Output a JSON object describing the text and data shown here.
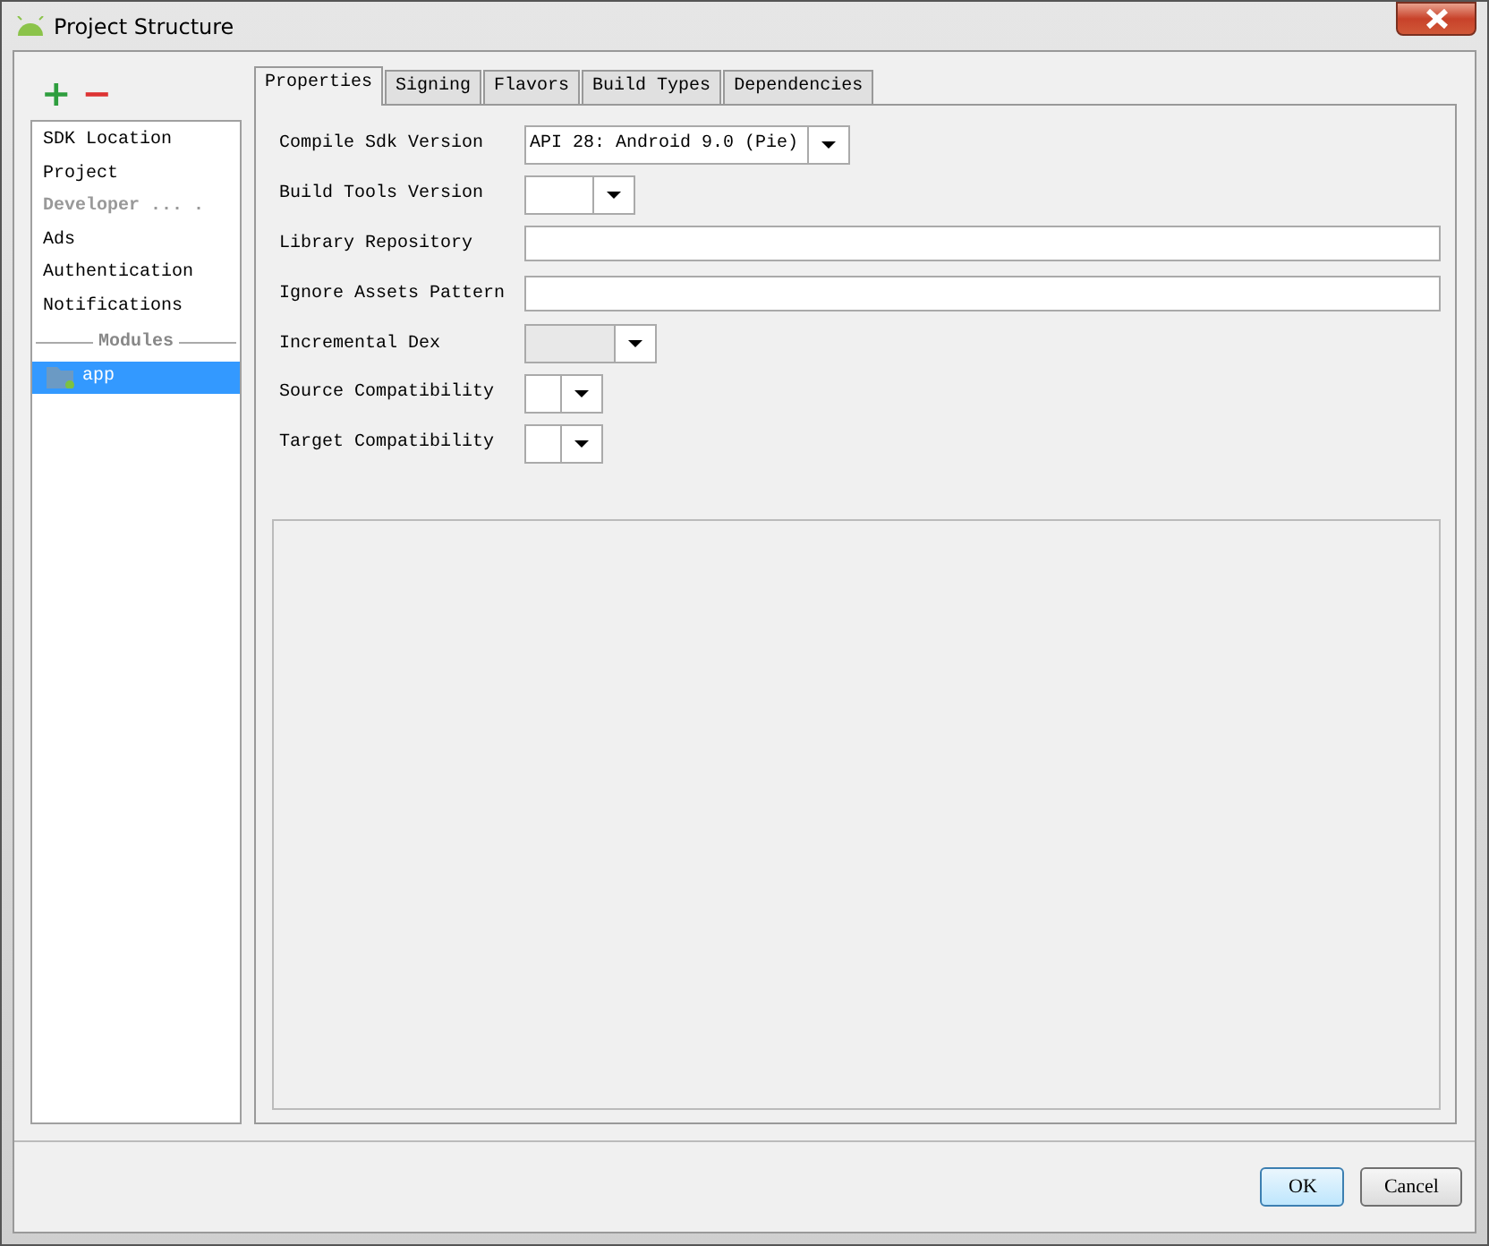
{
  "window": {
    "title": "Project Structure"
  },
  "toolbar": {
    "add": "+",
    "remove": "−"
  },
  "sidebar": {
    "items": [
      {
        "kind": "item",
        "label": "SDK Location",
        "selected": false
      },
      {
        "kind": "item",
        "label": "Project",
        "selected": false
      },
      {
        "kind": "disabled",
        "label": "Developer ... ."
      },
      {
        "kind": "item",
        "label": "Ads",
        "selected": false
      },
      {
        "kind": "item",
        "label": "Authentication",
        "selected": false
      },
      {
        "kind": "item",
        "label": "Notifications",
        "selected": false
      },
      {
        "kind": "section",
        "label": "Modules"
      },
      {
        "kind": "module",
        "label": "app",
        "selected": true
      }
    ]
  },
  "tabs": [
    {
      "label": "Properties",
      "selected": true
    },
    {
      "label": "Signing",
      "selected": false
    },
    {
      "label": "Flavors",
      "selected": false
    },
    {
      "label": "Build Types",
      "selected": false
    },
    {
      "label": "Dependencies",
      "selected": false
    }
  ],
  "form": {
    "rows": [
      {
        "kind": "combo",
        "label": "Compile Sdk Version",
        "value": "API 28: Android 9.0 (Pie)",
        "disabled": false
      },
      {
        "kind": "combo",
        "label": "Build Tools Version",
        "disabled": false
      },
      {
        "kind": "text",
        "label": "Library Repository"
      },
      {
        "kind": "text",
        "label": "Ignore Assets Pattern"
      },
      {
        "kind": "combo",
        "label": "Incremental Dex",
        "disabled": true
      },
      {
        "kind": "combo",
        "label": "Source Compatibility",
        "disabled": false
      },
      {
        "kind": "combo",
        "label": "Target Compatibility",
        "disabled": false
      }
    ]
  },
  "buttons": [
    {
      "label": "OK",
      "selected": true
    },
    {
      "label": "Cancel",
      "selected": false
    }
  ]
}
